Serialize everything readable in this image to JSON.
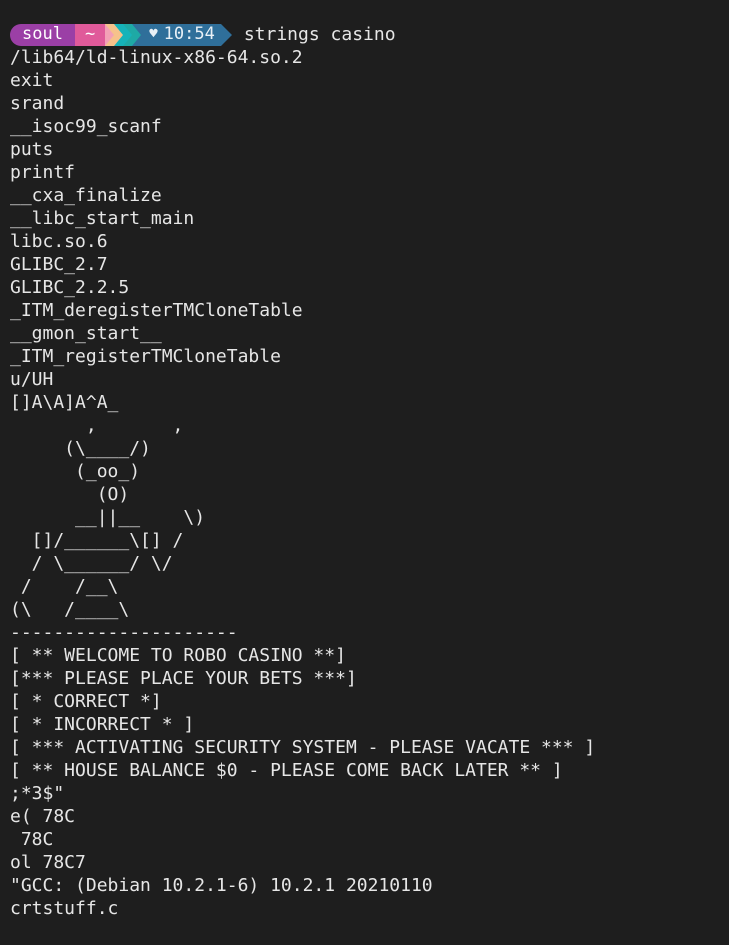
{
  "prompt": {
    "user": "soul",
    "directory": "~",
    "heart_icon": "♥",
    "time": "10:54",
    "command": "strings casino",
    "colors": {
      "user_bg": "#9b3fa6",
      "dir_bg": "#e05a9a",
      "time_bg": "#2f6f9a"
    }
  },
  "output_lines": [
    "/lib64/ld-linux-x86-64.so.2",
    "exit",
    "srand",
    "__isoc99_scanf",
    "puts",
    "printf",
    "__cxa_finalize",
    "__libc_start_main",
    "libc.so.6",
    "GLIBC_2.7",
    "GLIBC_2.2.5",
    "_ITM_deregisterTMCloneTable",
    "__gmon_start__",
    "_ITM_registerTMCloneTable",
    "u/UH",
    "[]A\\A]A^A_",
    "       ,       ,",
    "     (\\____/)",
    "      (_oo_)",
    "        (O)",
    "      __||__    \\)",
    "  []/______\\[] /",
    "  / \\______/ \\/",
    " /    /__\\",
    "(\\   /____\\",
    "---------------------",
    "[ ** WELCOME TO ROBO CASINO **]",
    "[*** PLEASE PLACE YOUR BETS ***]",
    "[ * CORRECT *]",
    "[ * INCORRECT * ]",
    "[ *** ACTIVATING SECURITY SYSTEM - PLEASE VACATE *** ]",
    "[ ** HOUSE BALANCE $0 - PLEASE COME BACK LATER ** ]",
    ";*3$\"",
    "e( 78C",
    " 78C",
    "ol 78C7",
    "\"GCC: (Debian 10.2.1-6) 10.2.1 20210110",
    "crtstuff.c"
  ]
}
